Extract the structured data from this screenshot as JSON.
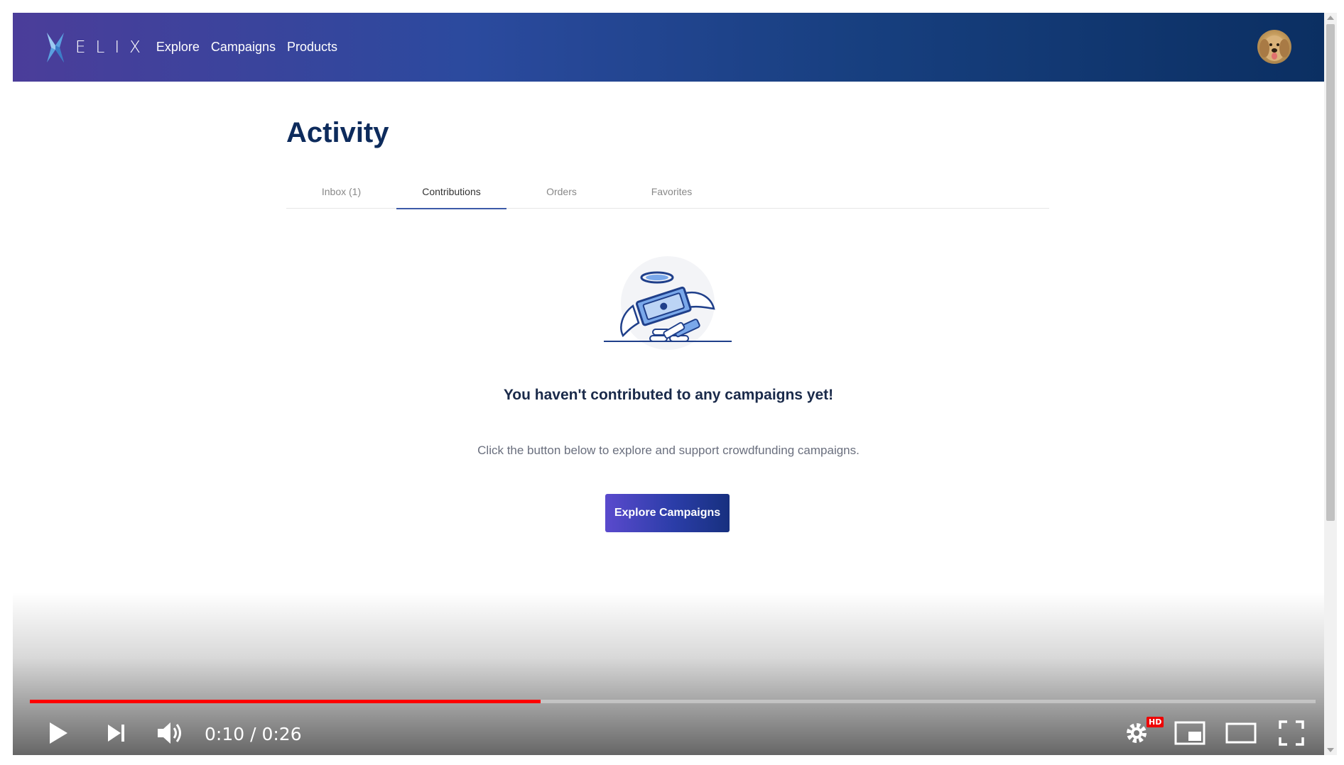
{
  "header": {
    "logo_text": "ELIX",
    "nav": [
      "Explore",
      "Campaigns",
      "Products"
    ]
  },
  "page": {
    "title": "Activity",
    "tabs": [
      {
        "label": "Inbox (1)",
        "active": false
      },
      {
        "label": "Contributions",
        "active": true
      },
      {
        "label": "Orders",
        "active": false
      },
      {
        "label": "Favorites",
        "active": false
      }
    ],
    "empty_state": {
      "heading": "You haven't contributed to any campaigns yet!",
      "subtext": "Click the button below to explore and support crowdfunding campaigns.",
      "button_label": "Explore Campaigns"
    }
  },
  "video": {
    "current_time": "0:10",
    "duration": "0:26",
    "time_display": "0:10 / 0:26",
    "progress_fraction": 0.397,
    "hd_badge": "HD"
  },
  "colors": {
    "title": "#0d2b5c",
    "accent": "#3d5aa8",
    "progress": "#ff0000"
  }
}
